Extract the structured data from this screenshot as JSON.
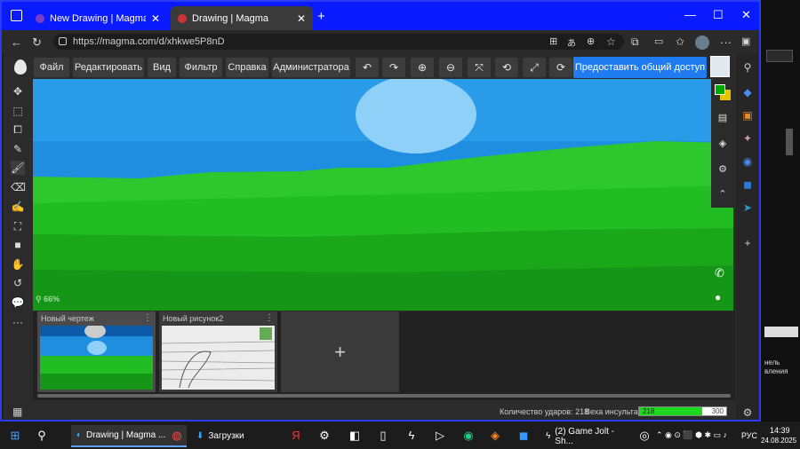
{
  "browser": {
    "tabs": [
      {
        "label": "New Drawing | Magma - The bro",
        "close": "✕"
      },
      {
        "label": "Drawing | Magma",
        "close": "✕"
      }
    ],
    "new_tab": "+",
    "window_controls": {
      "minimize": "—",
      "maximize": "☐",
      "close": "✕"
    },
    "url": "https://magma.com/d/xhkwe5P8nD"
  },
  "app": {
    "menu": [
      "Файл",
      "Редактировать",
      "Вид",
      "Фильтр",
      "Справка",
      "Администратора"
    ],
    "share_label": "Предоставить общий доступ",
    "zoom_label": "66%",
    "documents": [
      {
        "title": "Новый чертеж"
      },
      {
        "title": "Новый рисунок2"
      }
    ],
    "add_document": "+",
    "status": {
      "strokes_label": "Количество ударов: 218",
      "stroke_weight_label": "Веха инсульта:",
      "stroke_weight_value": "218",
      "stroke_weight_max": "300",
      "stroke_progress": 0.727
    },
    "colors": {
      "primary": "#00aa00",
      "secondary": "#e8c400",
      "accent": "#1e7bf0"
    }
  },
  "desktop": {
    "side_text_1": "нель",
    "side_text_2": "вления"
  },
  "taskbar": {
    "apps": [
      {
        "label": "Drawing | Magma ..."
      },
      {
        "label": "Загрузки"
      },
      {
        "label": "(2) Game Jolt - Sh..."
      }
    ],
    "lang": "РУС",
    "time": "14:39",
    "date": "24.08.2025"
  }
}
